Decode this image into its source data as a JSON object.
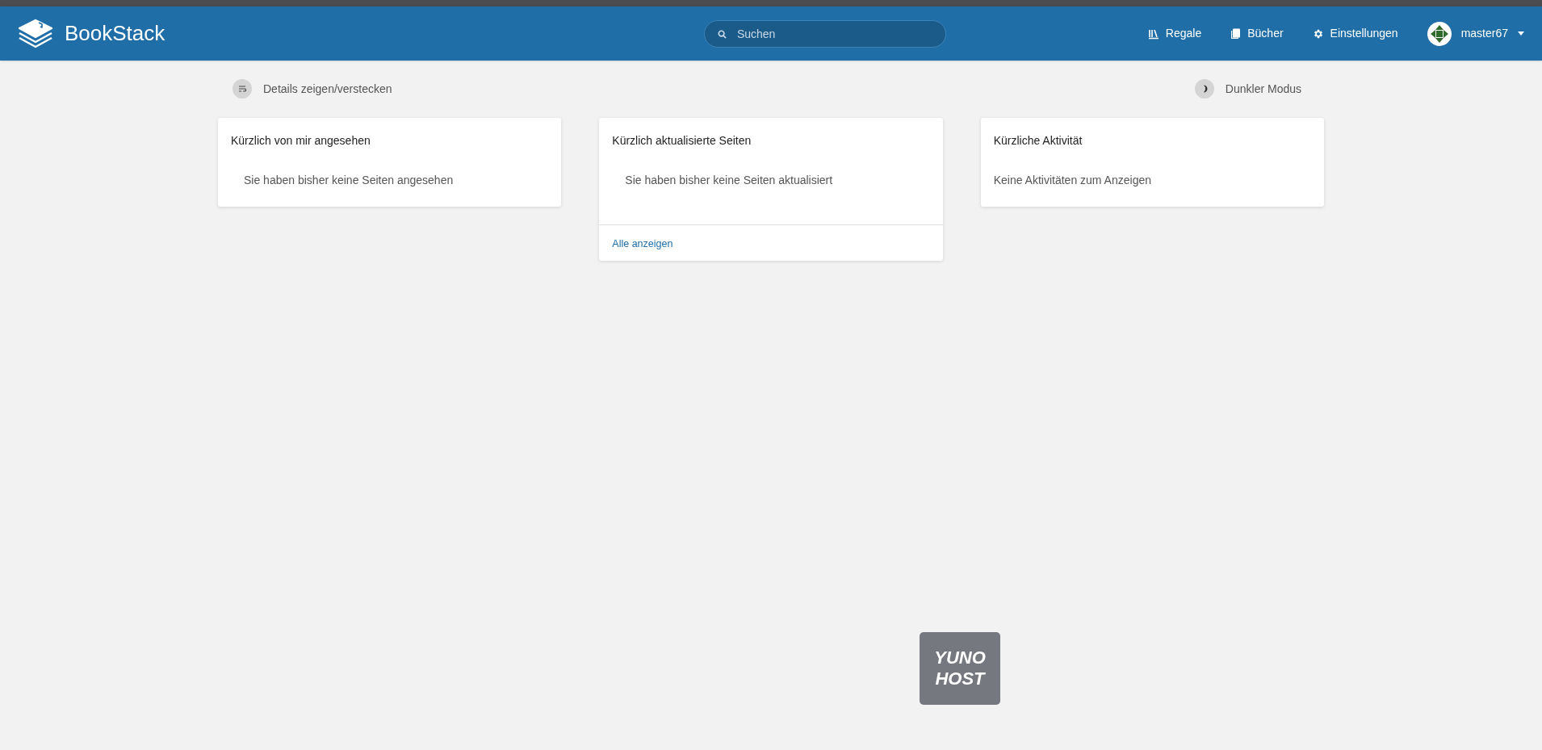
{
  "header": {
    "app_name": "BookStack",
    "search": {
      "placeholder": "Suchen"
    },
    "nav": [
      {
        "kind": "shelves",
        "label": "Regale"
      },
      {
        "kind": "books",
        "label": "Bücher"
      },
      {
        "kind": "settings",
        "label": "Einstellungen"
      }
    ],
    "user": {
      "name": "master67"
    }
  },
  "toolbar": {
    "details_toggle": "Details zeigen/verstecken",
    "dark_mode": "Dunkler Modus"
  },
  "cards": [
    {
      "title": "Kürzlich von mir angesehen",
      "empty_text": "Sie haben bisher keine Seiten angesehen",
      "indented": true
    },
    {
      "title": "Kürzlich aktualisierte Seiten",
      "empty_text": "Sie haben bisher keine Seiten aktualisiert",
      "indented": true,
      "footer_link": "Alle anzeigen"
    },
    {
      "title": "Kürzliche Aktivität",
      "empty_text": "Keine Aktivitäten zum Anzeigen",
      "indented": false
    }
  ],
  "portal_button": {
    "lines": [
      "YUNO",
      "HOST"
    ]
  }
}
